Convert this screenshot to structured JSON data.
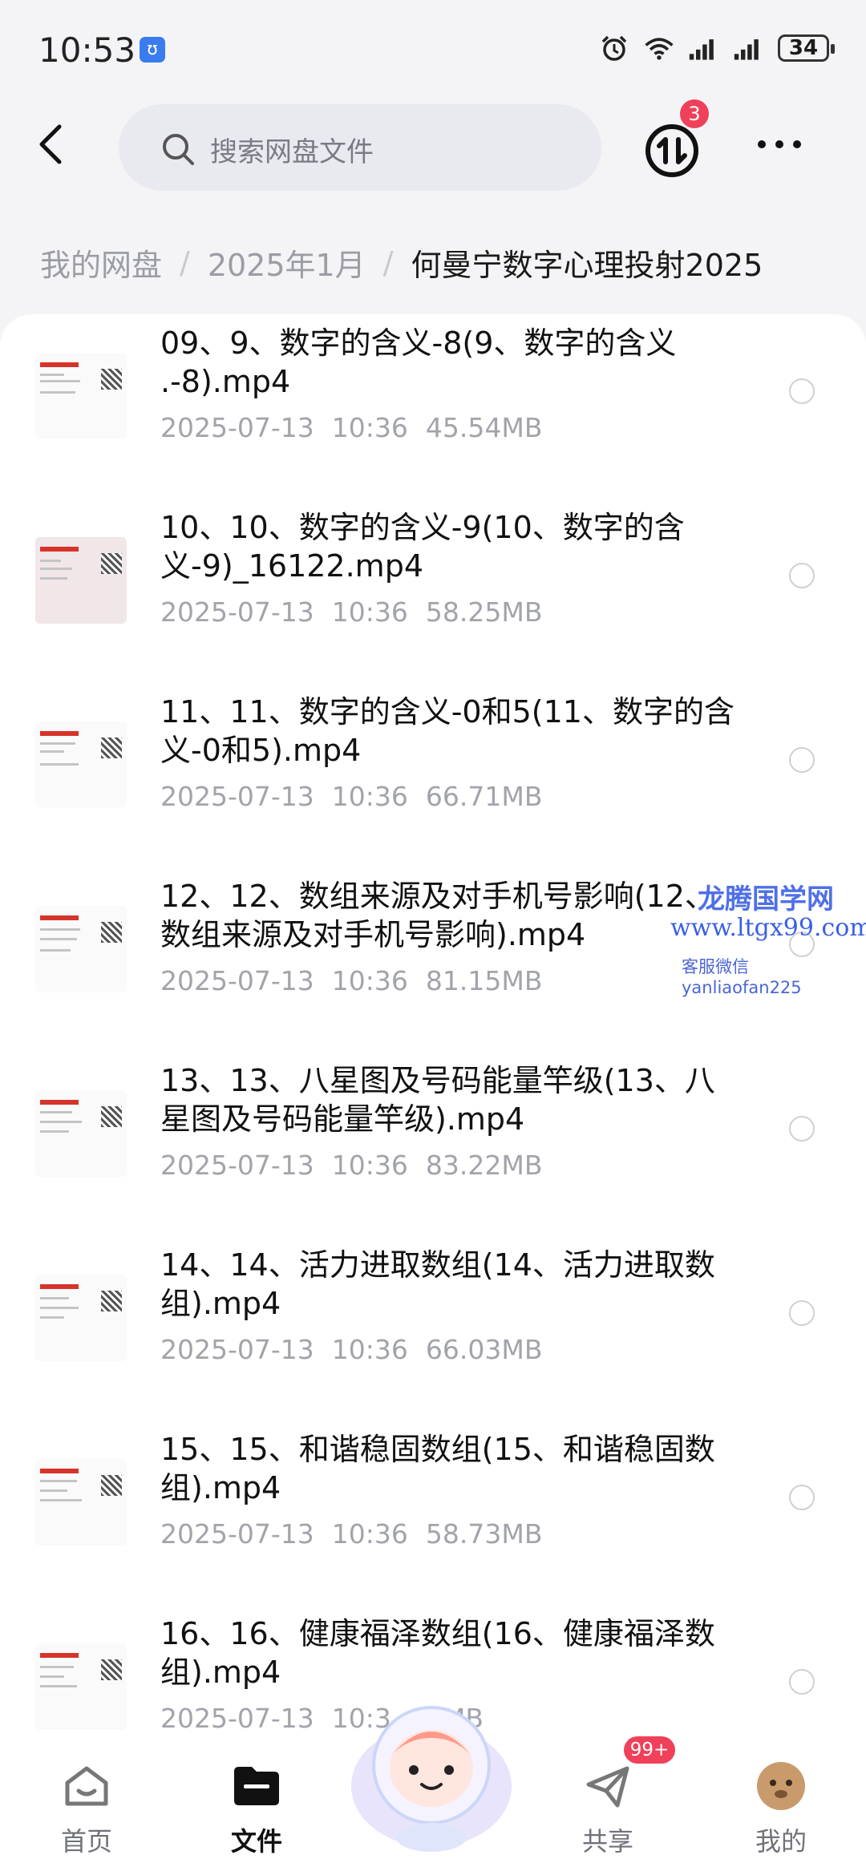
{
  "status_bar": {
    "time": "10:53",
    "battery": "34"
  },
  "search": {
    "placeholder": "搜索网盘文件"
  },
  "transfer": {
    "badge": "3"
  },
  "breadcrumb": {
    "items": [
      "我的网盘",
      "2025年1月",
      "何曼宁数字心理投射2025"
    ]
  },
  "files": [
    {
      "name": "09、9、数字的含义-8(9、数字的含义 .-8).mp4",
      "date": "2025-07-13",
      "time": "10:36",
      "size": "45.54MB"
    },
    {
      "name": "10、10、数字的含义-9(10、数字的含义-9)_16122.mp4",
      "date": "2025-07-13",
      "time": "10:36",
      "size": "58.25MB"
    },
    {
      "name": "11、11、数字的含义-0和5(11、数字的含义-0和5).mp4",
      "date": "2025-07-13",
      "time": "10:36",
      "size": "66.71MB"
    },
    {
      "name": "12、12、数组来源及对手机号影响(12、数组来源及对手机号影响).mp4",
      "date": "2025-07-13",
      "time": "10:36",
      "size": "81.15MB"
    },
    {
      "name": "13、13、八星图及号码能量竿级(13、八星图及号码能量竿级).mp4",
      "date": "2025-07-13",
      "time": "10:36",
      "size": "83.22MB"
    },
    {
      "name": "14、14、活力进取数组(14、活力进取数组).mp4",
      "date": "2025-07-13",
      "time": "10:36",
      "size": "66.03MB"
    },
    {
      "name": "15、15、和谐稳固数组(15、和谐稳固数组).mp4",
      "date": "2025-07-13",
      "time": "10:36",
      "size": "58.73MB"
    },
    {
      "name": "16、16、健康福泽数组(16、健康福泽数组).mp4",
      "date": "2025-07-13",
      "time": "10:3",
      "size": "12MB"
    }
  ],
  "watermark": {
    "line1": "龙腾国学网",
    "line2": "www.ltgx99.com",
    "line3": "客服微信 yanliaofan225"
  },
  "tabs": [
    {
      "label": "首页",
      "icon": "home-icon"
    },
    {
      "label": "文件",
      "icon": "folder-icon"
    },
    {
      "label": "共享",
      "icon": "share-icon",
      "badge": "99+"
    },
    {
      "label": "我的",
      "icon": "avatar-icon"
    }
  ],
  "colors": {
    "accent_badge": "#f0405a",
    "watermark": "#4f6fe8"
  }
}
